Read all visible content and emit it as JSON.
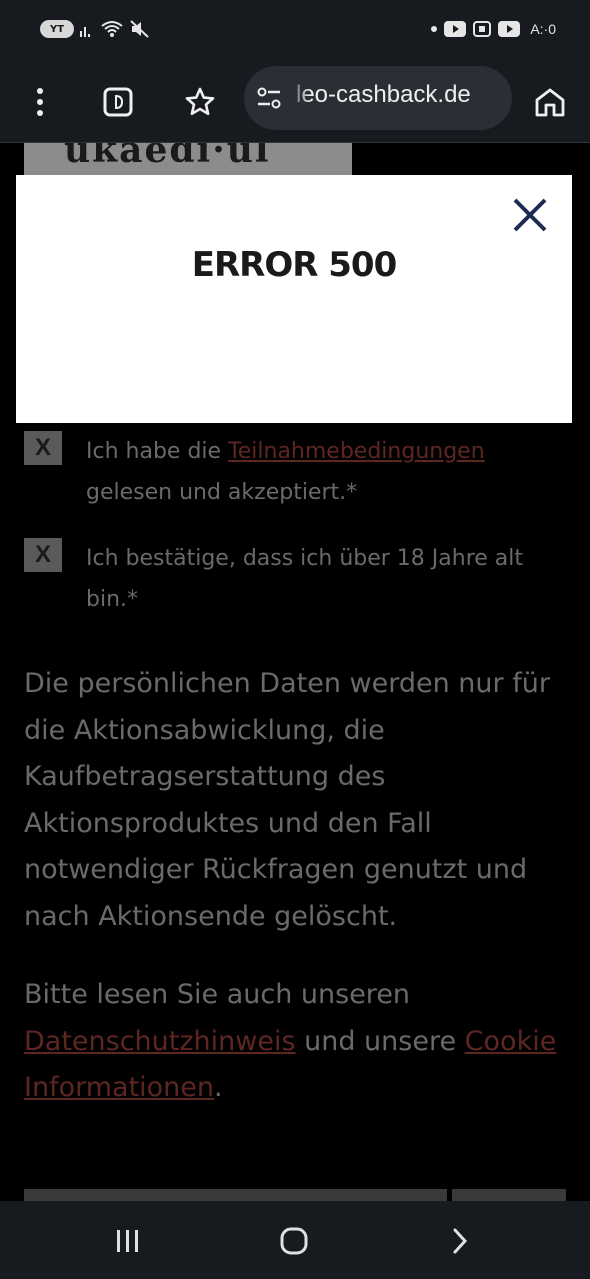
{
  "status_bar": {
    "sim_badge": "YT",
    "time": "A:·0"
  },
  "browser": {
    "url": "leo-cashback.de"
  },
  "page": {
    "logo_text": "ukaedi·ul",
    "checkboxes": [
      {
        "mark": "X",
        "text_before": "Ich habe die ",
        "link": "Teilnahmebedingungen",
        "text_after": " gelesen und akzeptiert.*"
      },
      {
        "mark": "X",
        "text": "Ich bestätige, dass ich über 18 Jahre alt bin.*"
      }
    ],
    "privacy_text": "Die persönlichen Daten werden nur für die Aktionsabwicklung, die Kaufbetragserstattung des Aktionsproduktes und den Fall notwendiger Rückfragen genutzt und nach Aktionsende gelöscht.",
    "notice": {
      "before": "Bitte lesen Sie auch unseren ",
      "link1": "Datenschutzhinweis",
      "middle": " und unsere ",
      "link2": "Cookie Informationen",
      "after": "."
    }
  },
  "modal": {
    "title": "ERROR 500"
  },
  "colors": {
    "chrome": "#171a1e",
    "url_pill": "#2a2f36",
    "modal_bg": "#ffffff",
    "close_icon": "#1d2a52",
    "dim_link": "#5e2622"
  }
}
